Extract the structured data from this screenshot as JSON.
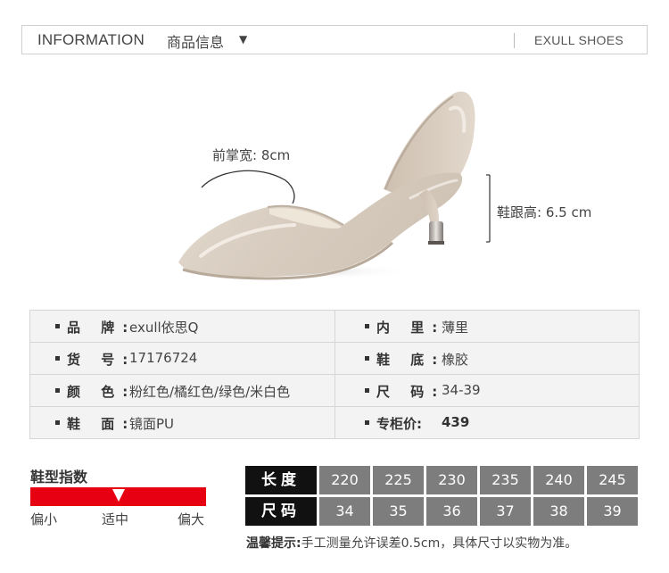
{
  "header": {
    "title_en": "INFORMATION",
    "title_cn": "商品信息",
    "arrow": "▼",
    "brand": "EXULL SHOES"
  },
  "annotations": {
    "forefoot_width": "前掌宽: 8cm",
    "heel_height": "鞋跟高: 6.5 cm"
  },
  "info": {
    "rows": [
      {
        "left_label": "品 牌:",
        "left_value": "exull依思Q",
        "right_label": "内 里:",
        "right_value": "薄里"
      },
      {
        "left_label": "货 号:",
        "left_value": "17176724",
        "right_label": "鞋 底:",
        "right_value": "橡胶"
      },
      {
        "left_label": "颜 色:",
        "left_value": "粉红色/橘红色/绿色/米白色",
        "right_label": "尺 码:",
        "right_value": "34-39"
      },
      {
        "left_label": "鞋 面:",
        "left_value": "镜面PU",
        "right_label": "专柜价:",
        "right_value": "439"
      }
    ]
  },
  "fit": {
    "title": "鞋型指数",
    "small": "偏小",
    "fit": "适中",
    "large": "偏大",
    "level": 0.5,
    "bar_color": "#e60012"
  },
  "sizes": {
    "length_label": "长度",
    "size_label": "尺码",
    "lengths": [
      "220",
      "225",
      "230",
      "235",
      "240",
      "245"
    ],
    "codes": [
      "34",
      "35",
      "36",
      "37",
      "38",
      "39"
    ]
  },
  "tip": {
    "label": "温馨提示:",
    "text": "手工测量允许误差0.5cm，具体尺寸以实物为准。"
  }
}
